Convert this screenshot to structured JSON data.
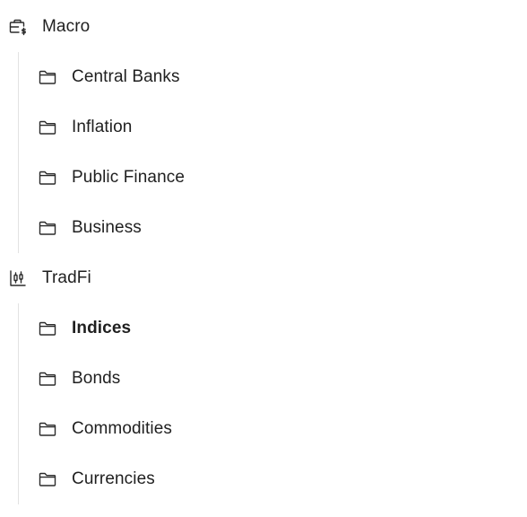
{
  "sections": [
    {
      "label": "Macro",
      "icon": "briefcase-dollar-icon",
      "items": [
        {
          "label": "Central Banks",
          "icon": "folder-icon",
          "active": false
        },
        {
          "label": "Inflation",
          "icon": "folder-icon",
          "active": false
        },
        {
          "label": "Public Finance",
          "icon": "folder-icon",
          "active": false
        },
        {
          "label": "Business",
          "icon": "folder-icon",
          "active": false
        }
      ]
    },
    {
      "label": "TradFi",
      "icon": "candlestick-chart-icon",
      "items": [
        {
          "label": "Indices",
          "icon": "folder-icon",
          "active": true
        },
        {
          "label": "Bonds",
          "icon": "folder-icon",
          "active": false
        },
        {
          "label": "Commodities",
          "icon": "folder-icon",
          "active": false
        },
        {
          "label": "Currencies",
          "icon": "folder-icon",
          "active": false
        }
      ]
    }
  ],
  "colors": {
    "text": "#1f1f1f",
    "icon": "#2b2b2b",
    "guide_line": "#e2e2e2",
    "background": "#ffffff"
  }
}
